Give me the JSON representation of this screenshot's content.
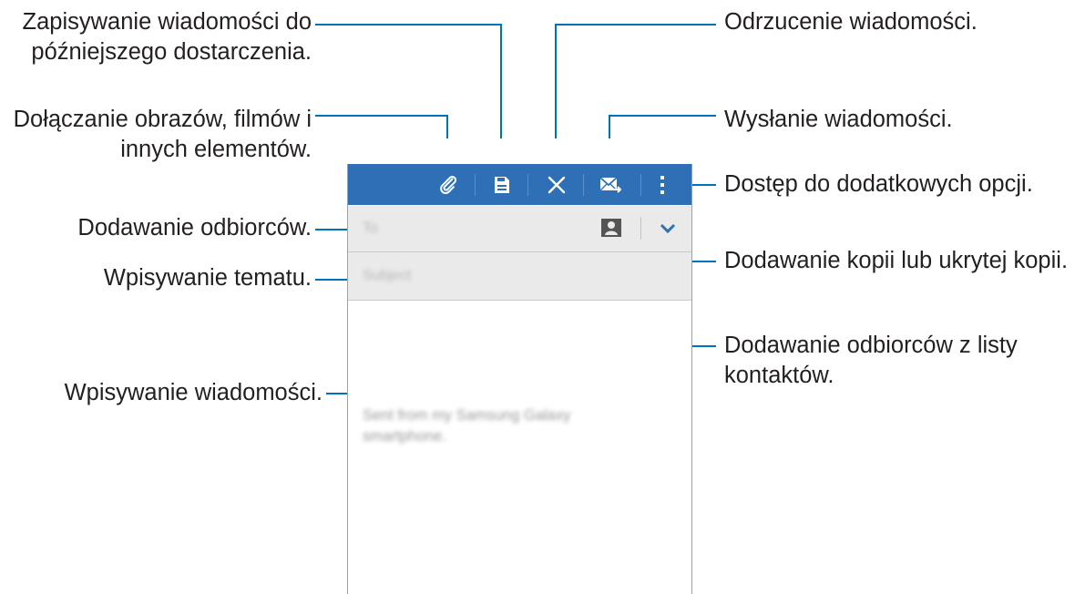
{
  "annotations": {
    "save_for_later": [
      "Zapisywanie wiadomości do",
      "późniejszego dostarczenia."
    ],
    "attach": [
      "Dołączanie obrazów, filmów i",
      "innych elementów."
    ],
    "add_recipients": "Dodawanie odbiorców.",
    "enter_subject": "Wpisywanie tematu.",
    "enter_message": "Wpisywanie wiadomości.",
    "discard": "Odrzucenie wiadomości.",
    "send": "Wysłanie wiadomości.",
    "more_options": "Dostęp do dodatkowych opcji.",
    "cc_bcc": "Dodawanie kopii lub ukrytej kopii.",
    "from_contacts": [
      "Dodawanie odbiorców z listy",
      "kontaktów."
    ]
  },
  "compose": {
    "to_placeholder": "To",
    "subject_placeholder": "Subject",
    "signature": "Sent from my Samsung Galaxy smartphone."
  },
  "colors": {
    "action_bar": "#2e6fb5",
    "field_background": "#eaeaea",
    "callout_line": "#0072bc"
  },
  "icons": [
    "attach-icon",
    "save-icon",
    "discard-icon",
    "send-icon",
    "more-options-icon",
    "contact-icon",
    "expand-icon"
  ]
}
